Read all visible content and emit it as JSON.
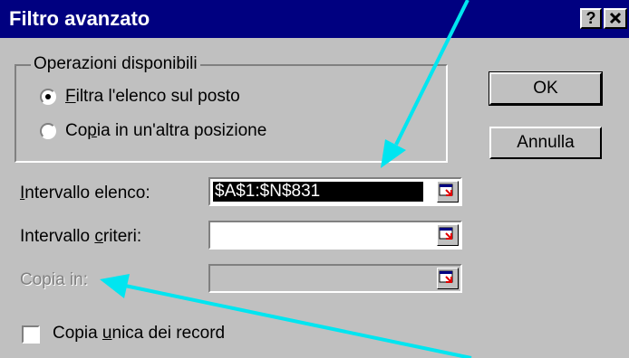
{
  "window": {
    "title": "Filtro avanzato",
    "help_button": "?",
    "close_button": "✕"
  },
  "group": {
    "legend": "Operazioni disponibili",
    "options": [
      {
        "accel": "F",
        "rest": "iltra l'elenco sul posto",
        "selected": true
      },
      {
        "pre": "Co",
        "accel": "p",
        "rest": "ia in un'altra posizione",
        "selected": false
      }
    ]
  },
  "buttons": {
    "ok": "OK",
    "cancel": "Annulla"
  },
  "fields": {
    "list_range": {
      "label_accel": "I",
      "label_rest": "ntervallo elenco:",
      "value": "$A$1:$N$831"
    },
    "criteria_range": {
      "label_pre": "Intervallo ",
      "label_accel": "c",
      "label_rest": "riteri:",
      "value": ""
    },
    "copy_to": {
      "label": "Copia in:",
      "value": "",
      "disabled": true
    }
  },
  "checkbox": {
    "label_pre": "Copia ",
    "label_accel": "u",
    "label_rest": "nica dei record",
    "checked": false
  },
  "colors": {
    "titlebar": "#000080",
    "face": "#c0c0c0",
    "annotation_arrow": "#00e5f0"
  }
}
